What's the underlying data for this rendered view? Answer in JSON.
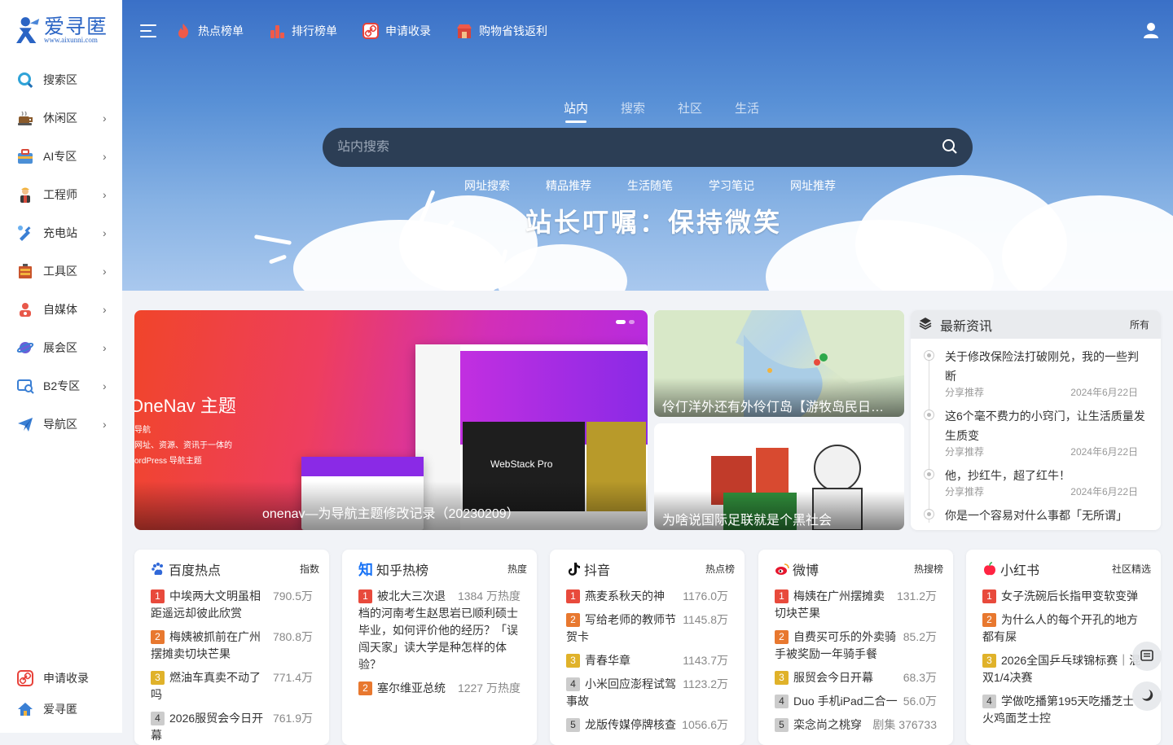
{
  "logo": {
    "cn": "爱寻匿",
    "url": "www.aixunni.com"
  },
  "sidebar": {
    "items": [
      {
        "label": "搜索区",
        "has_arrow": false
      },
      {
        "label": "休闲区",
        "has_arrow": true
      },
      {
        "label": "AI专区",
        "has_arrow": true
      },
      {
        "label": "工程师",
        "has_arrow": true
      },
      {
        "label": "充电站",
        "has_arrow": true
      },
      {
        "label": "工具区",
        "has_arrow": true
      },
      {
        "label": "自媒体",
        "has_arrow": true
      },
      {
        "label": "展会区",
        "has_arrow": true
      },
      {
        "label": "B2专区",
        "has_arrow": true
      },
      {
        "label": "导航区",
        "has_arrow": true
      }
    ],
    "bottom": [
      {
        "label": "申请收录"
      },
      {
        "label": "爱寻匿"
      }
    ]
  },
  "topnav": {
    "links": [
      {
        "label": "热点榜单"
      },
      {
        "label": "排行榜单"
      },
      {
        "label": "申请收录"
      },
      {
        "label": "购物省钱返利"
      }
    ]
  },
  "hero": {
    "tabs": [
      "站内",
      "搜索",
      "社区",
      "生活"
    ],
    "active_tab": "站内",
    "search_placeholder": "站内搜索",
    "quick_links": [
      "网址搜索",
      "精品推荐",
      "生活随笔",
      "学习笔记",
      "网址推荐"
    ],
    "slogan": "站长叮嘱：保持微笑"
  },
  "banner": {
    "title": "OneNav 主题",
    "sub1": "导航",
    "sub2": "网址、资源、资讯于一体的",
    "sub3": "ordPress 导航主题",
    "mock_label": "WebStack Pro",
    "caption": "onenav—为导航主题修改记录（20230209）"
  },
  "cards": [
    {
      "caption": "伶仃洋外还有外伶仃岛【游牧岛民日记】"
    },
    {
      "caption": "为啥说国际足联就是个黑社会"
    }
  ],
  "news": {
    "title": "最新资讯",
    "all_label": "所有",
    "items": [
      {
        "text": "关于修改保险法打破刚兑，我的一些判断",
        "category": "分享推荐",
        "date": "2024年6月22日"
      },
      {
        "text": "这6个毫不费力的小窍门，让生活质量发生质变",
        "category": "分享推荐",
        "date": "2024年6月22日"
      },
      {
        "text": "他，抄红牛，超了红牛！",
        "category": "分享推荐",
        "date": "2024年6月22日"
      },
      {
        "text": "你是一个容易对什么事都「无所谓」",
        "category": "",
        "date": ""
      }
    ]
  },
  "hot_lists": [
    {
      "name": "百度热点",
      "tag": "指数",
      "items": [
        {
          "rank": "1",
          "title": "中埃两大文明虽相距遥远却彼此欣赏",
          "value": "790.5万"
        },
        {
          "rank": "2",
          "title": "梅姨被抓前在广州摆摊卖切块芒果",
          "value": "780.8万"
        },
        {
          "rank": "3",
          "title": "燃油车真卖不动了吗",
          "value": "771.4万"
        },
        {
          "rank": "4",
          "title": "2026服贸会今日开幕",
          "value": "761.9万"
        }
      ]
    },
    {
      "name": "知乎热榜",
      "tag": "热度",
      "items": [
        {
          "rank": "1",
          "title": "被北大三次退档的河南考生赵思岩已顺利硕士毕业，如何评价他的经历？「误闯天家」读大学是种怎样的体验？",
          "value": "1384 万热度"
        },
        {
          "rank": "2",
          "title": "塞尔维亚总统",
          "value": "1227 万热度"
        }
      ]
    },
    {
      "name": "抖音",
      "tag": "热点榜",
      "items": [
        {
          "rank": "1",
          "title": "燕麦系秋天的神",
          "value": "1176.0万"
        },
        {
          "rank": "2",
          "title": "写给老师的教师节贺卡",
          "value": "1145.8万"
        },
        {
          "rank": "3",
          "title": "青春华章",
          "value": "1143.7万"
        },
        {
          "rank": "4",
          "title": "小米回应澎程试驾事故",
          "value": "1123.2万"
        },
        {
          "rank": "5",
          "title": "龙版传媒停牌核查",
          "value": "1056.6万"
        }
      ]
    },
    {
      "name": "微博",
      "tag": "热搜榜",
      "items": [
        {
          "rank": "1",
          "title": "梅姨在广州摆摊卖切块芒果",
          "value": "131.2万"
        },
        {
          "rank": "2",
          "title": "自费买可乐的外卖骑手被奖励一年骑手餐",
          "value": "85.2万"
        },
        {
          "rank": "3",
          "title": "服贸会今日开幕",
          "value": "68.3万"
        },
        {
          "rank": "4",
          "title": "Duo 手机iPad二合一",
          "value": "56.0万"
        },
        {
          "rank": "5",
          "title": "栾念尚之桃穿",
          "value": "剧集 376733"
        }
      ]
    },
    {
      "name": "小红书",
      "tag": "社区精选",
      "items": [
        {
          "rank": "1",
          "title": "女子洗碗后长指甲变软变弹",
          "value": ""
        },
        {
          "rank": "2",
          "title": "为什么人的每个开孔的地方都有屎",
          "value": ""
        },
        {
          "rank": "3",
          "title": "2026全国乒乓球锦标赛｜混双1/4决赛",
          "value": ""
        },
        {
          "rank": "4",
          "title": "学做吃播第195天吃播芝士火鸡面芝士控",
          "value": ""
        }
      ]
    }
  ],
  "colors": {
    "accent": "#2a64c4",
    "search_bg": "#2c3e55",
    "rank1": "#e84a3c",
    "rank2": "#e8782f",
    "rank3": "#e0b22a"
  }
}
